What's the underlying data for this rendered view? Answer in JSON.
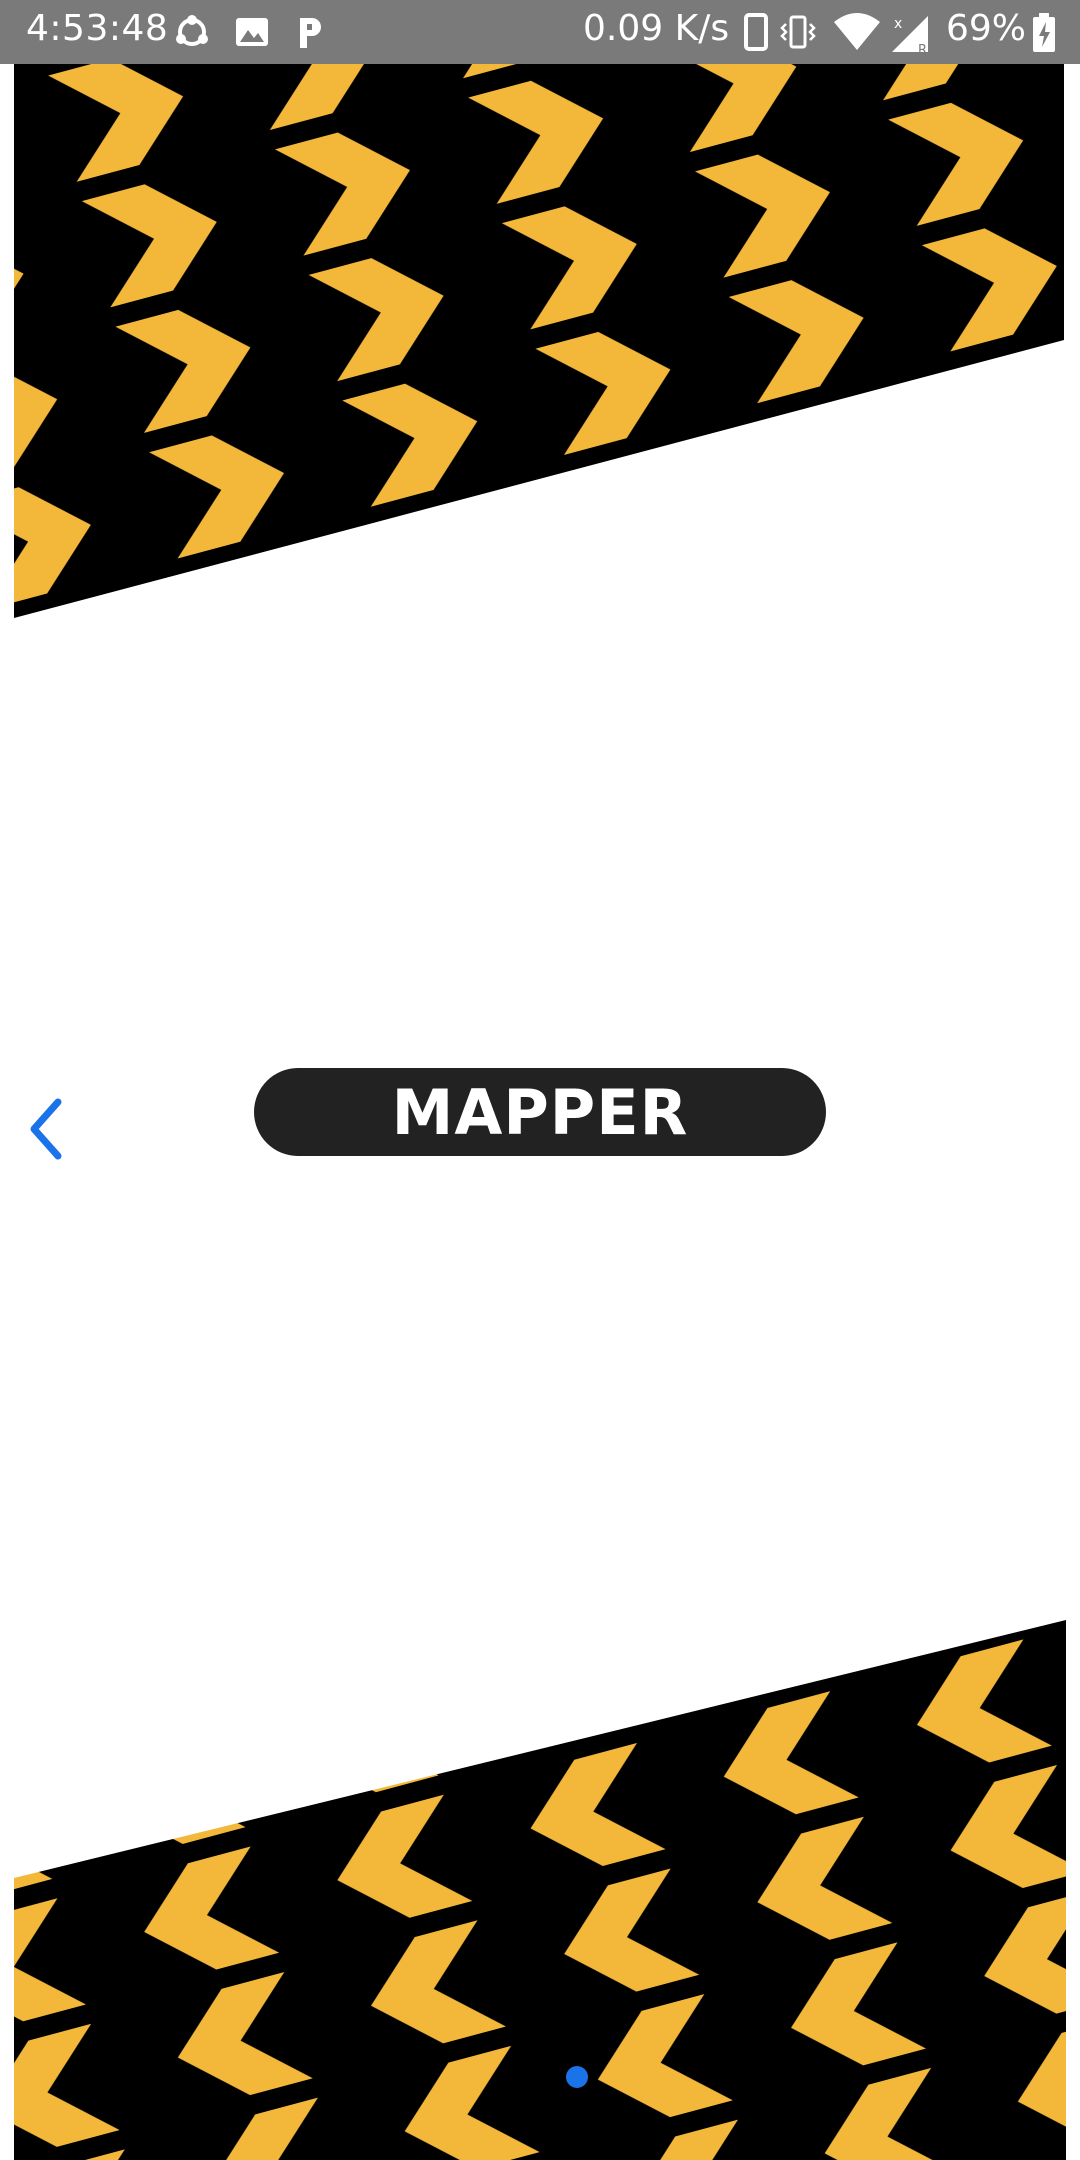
{
  "status_bar": {
    "time": "4:53:48",
    "network_speed": "0.09 K/s",
    "battery_percent": "69%",
    "icons": [
      "sync-icon",
      "image-icon",
      "p-app-icon",
      "phone-icon",
      "vibrate-icon",
      "wifi-icon",
      "signal-icon",
      "battery-icon"
    ]
  },
  "screen": {
    "title": "MAPPER",
    "back_icon": "chevron-left-icon"
  },
  "colors": {
    "status_bar_bg": "#7a7a7a",
    "hazard_yellow": "#f3b83a",
    "hazard_black": "#000000",
    "pill_bg": "#222222",
    "accent_blue": "#1a73e8"
  },
  "pager": {
    "total_pages": 1,
    "current_page": 1
  }
}
